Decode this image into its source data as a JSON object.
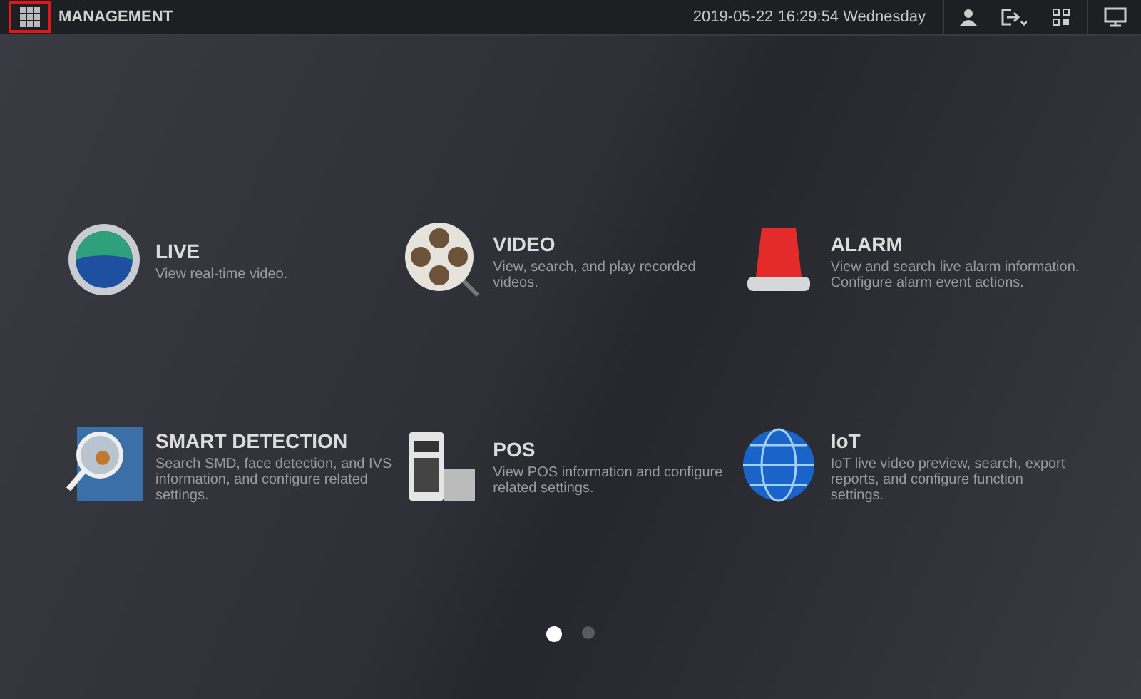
{
  "header": {
    "title": "MANAGEMENT",
    "datetime": "2019-05-22 16:29:54 Wednesday"
  },
  "tiles": [
    {
      "kind": "live",
      "title": "LIVE",
      "description": "View real-time video."
    },
    {
      "kind": "video",
      "title": "VIDEO",
      "description": "View, search, and play recorded videos."
    },
    {
      "kind": "alarm",
      "title": "ALARM",
      "description": "View and search live alarm information. Configure alarm event actions."
    },
    {
      "kind": "smart",
      "title": "SMART DETECTION",
      "description": "Search SMD, face detection, and IVS information, and configure related settings."
    },
    {
      "kind": "pos",
      "title": "POS",
      "description": "View POS information and configure related settings."
    },
    {
      "kind": "iot",
      "title": "IoT",
      "description": "IoT live video preview, search, export reports, and configure function settings."
    }
  ],
  "pages": [
    {
      "selected": true
    },
    {
      "selected": false
    }
  ]
}
